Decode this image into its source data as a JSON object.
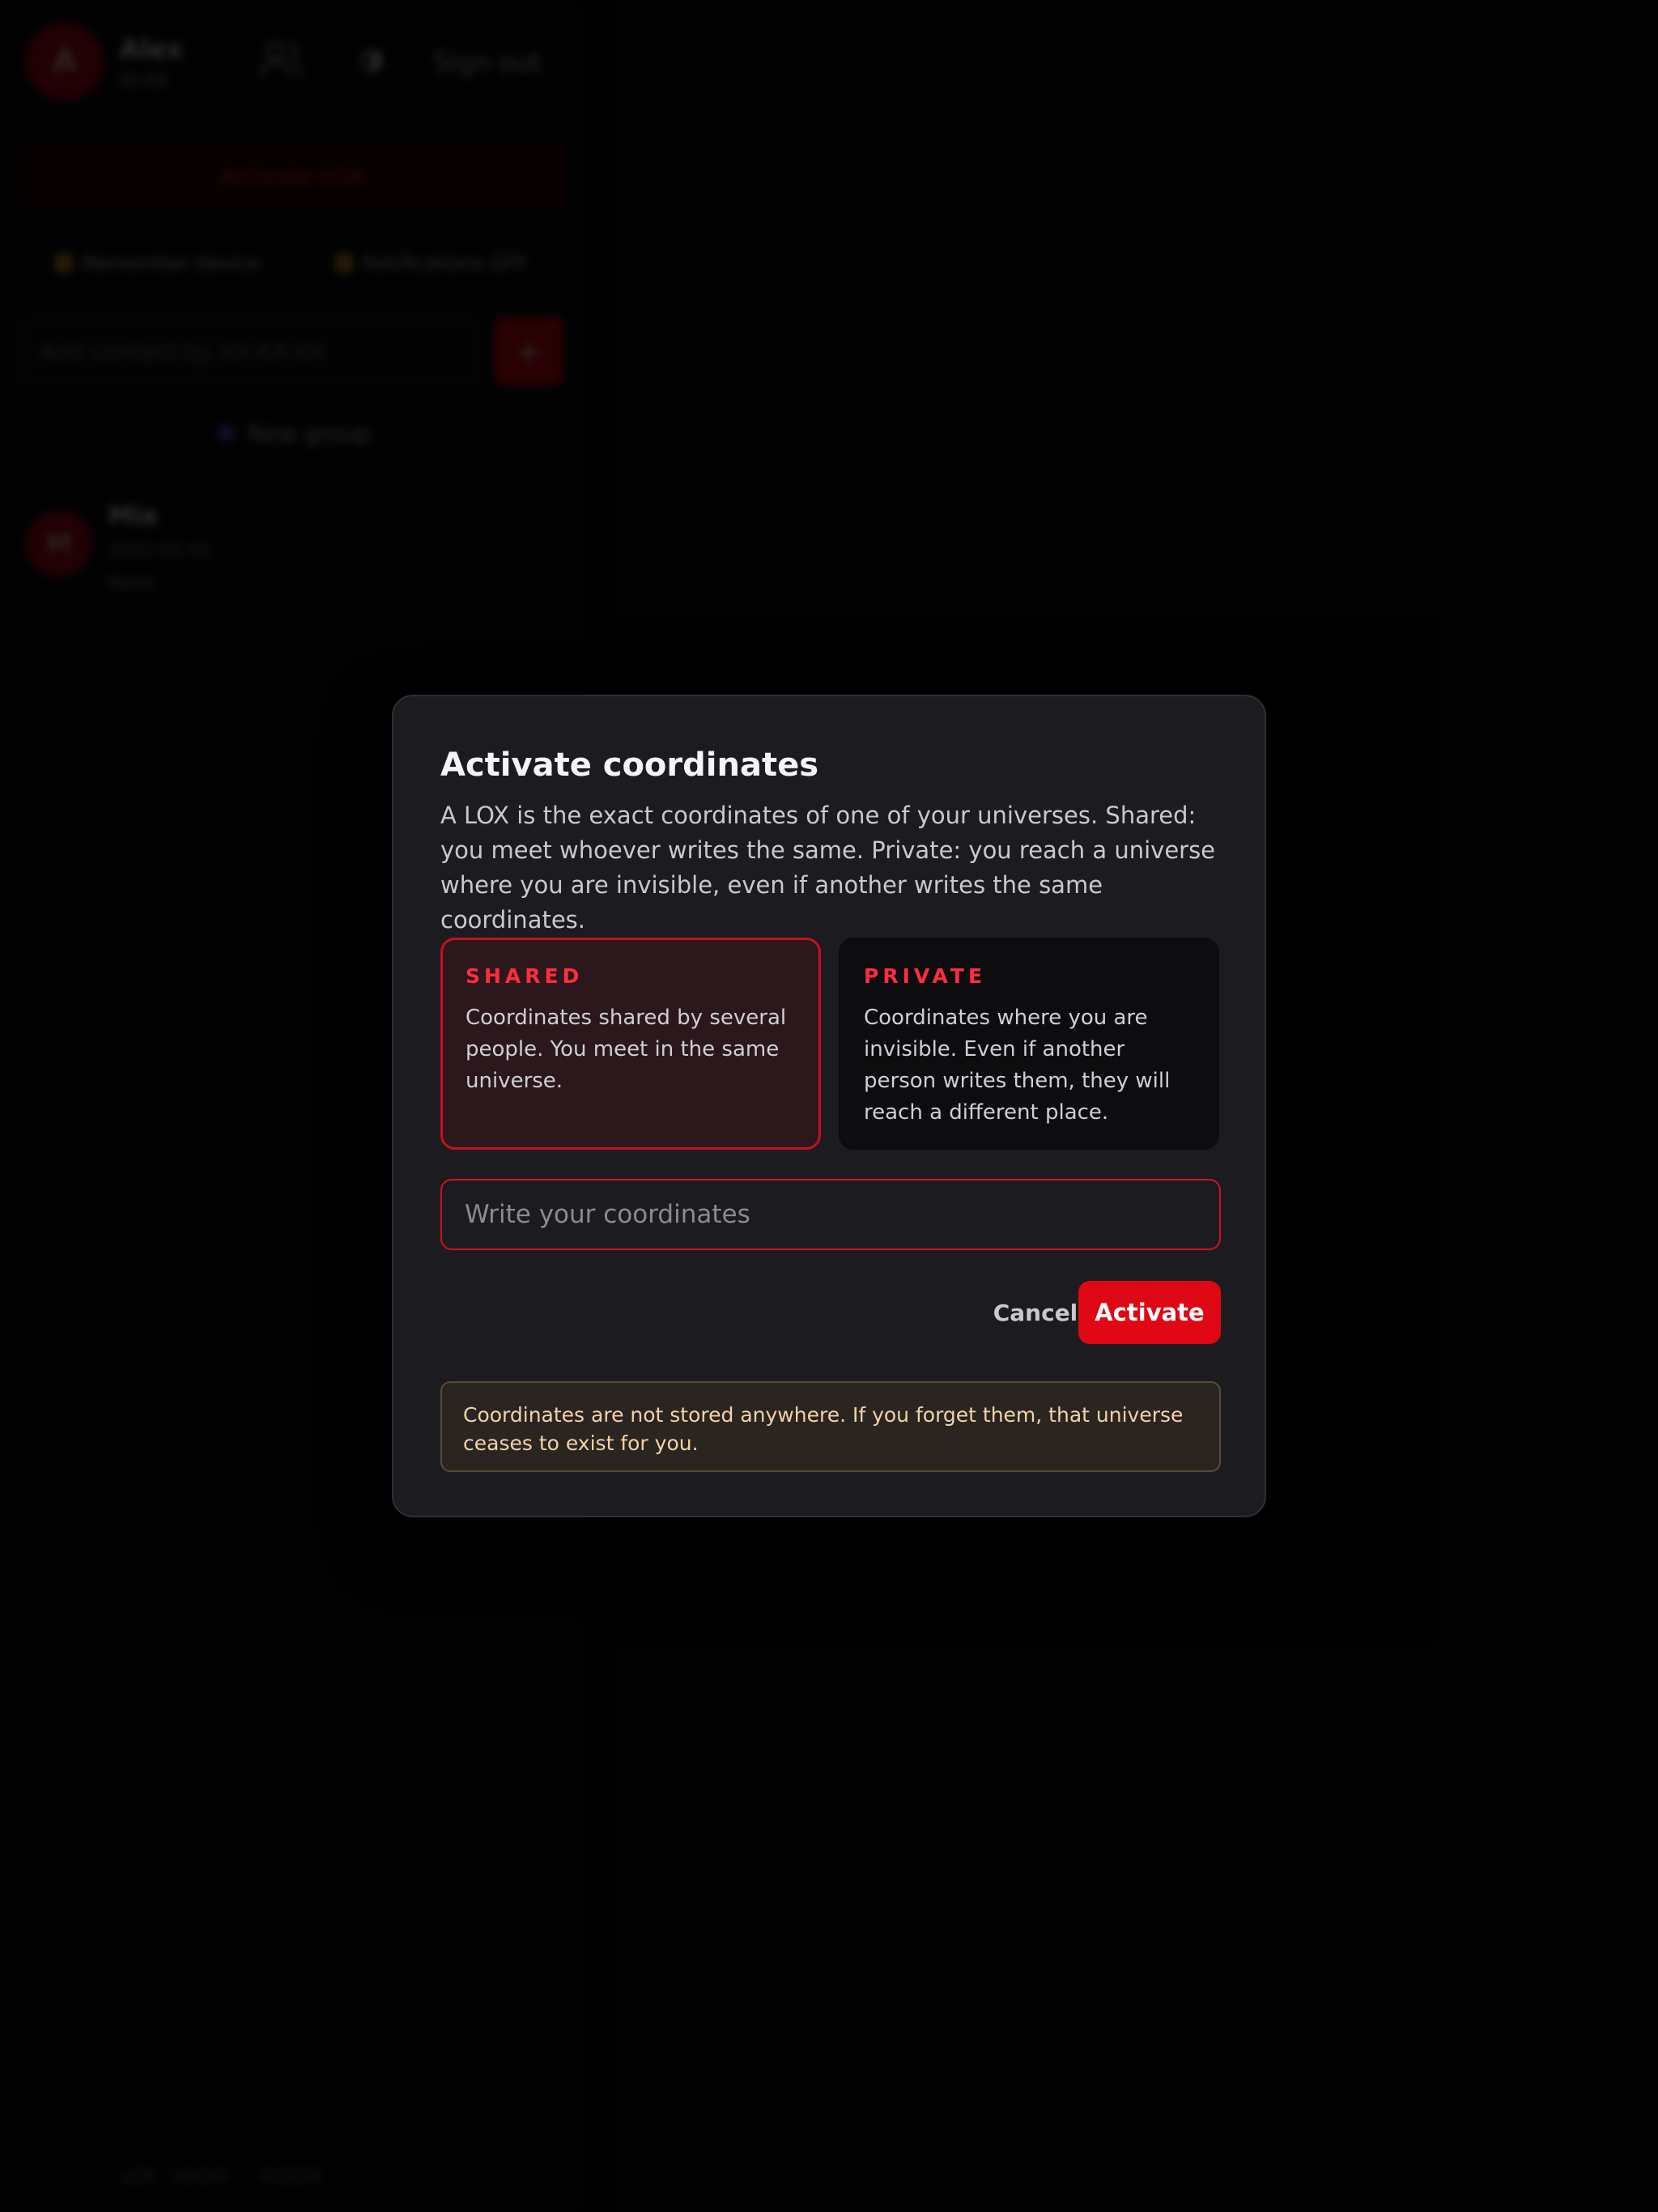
{
  "background_app": {
    "user": {
      "avatar_initial": "A",
      "name": "Alex",
      "subtitle": "ID:00"
    },
    "header": {
      "contacts_icon": "contacts-icon",
      "theme_icon": "theme-toggle-icon",
      "signout_label": "Sign out"
    },
    "activate_lox_label": "Activate LOX",
    "toggles": [
      {
        "label": "Remember device",
        "icon": "house-icon"
      },
      {
        "label": "Notifications OFF",
        "icon": "bell-icon"
      }
    ],
    "add_contact": {
      "placeholder": "Add contact by XX-XX-XX",
      "button_label": "+"
    },
    "new_group_label": "New group",
    "contacts": [
      {
        "initial": "M",
        "name": "Mia",
        "line1": "2022-05-01",
        "line2": "None"
      }
    ],
    "footer": "LOX · v0.0.0  ·  ©2024"
  },
  "modal": {
    "title": "Activate coordinates",
    "description": "A LOX is the exact coordinates of one of your universes. Shared: you meet whoever writes the same. Private: you reach a universe where you are invisible, even if another writes the same coordinates.",
    "modes": {
      "shared": {
        "title": "SHARED",
        "text": "Coordinates shared by several people. You meet in the same universe.",
        "selected": true
      },
      "private": {
        "title": "PRIVATE",
        "text": "Coordinates where you are invisible. Even if another person writes them, they will reach a different place.",
        "selected": false
      }
    },
    "coordinates_input": {
      "value": "",
      "placeholder": "Write your coordinates"
    },
    "cancel_label": "Cancel",
    "activate_label": "Activate",
    "warning": "Coordinates are not stored anywhere. If you forget them, that universe ceases to exist for you."
  },
  "colors": {
    "accent": "#e00714",
    "modal_bg": "#1c1c20",
    "warning_text": "#f2d3a8",
    "page_bg": "#030303"
  }
}
